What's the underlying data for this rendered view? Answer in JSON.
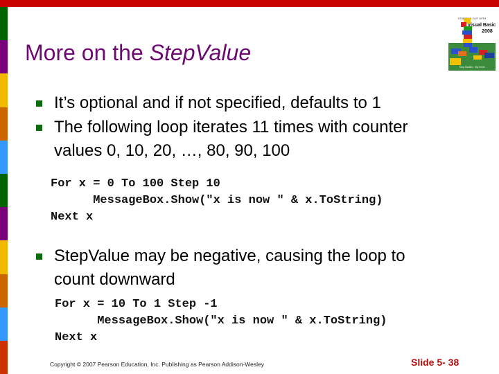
{
  "colors": {
    "top_bar": "#c80000",
    "title": "#6a0a6e",
    "bullet": "#0e6b0e",
    "slide_number": "#b01010",
    "side_stripes": [
      "#006400",
      "#7a007a",
      "#f2b800",
      "#cc6600",
      "#3399ff",
      "#006400",
      "#7a007a",
      "#f2b800",
      "#cc6600",
      "#3399ff",
      "#cc3300"
    ]
  },
  "title": {
    "prefix": "More on the ",
    "emphasis": "StepValue"
  },
  "bullets": [
    {
      "text": "It’s optional and if not specified, defaults to 1"
    },
    {
      "line1": "The following loop iterates 11 times with counter",
      "line2": "values 0, 10, 20, …, 80, 90, 100"
    },
    {
      "line1": "StepValue may be negative, causing the loop to",
      "line2": "count downward"
    }
  ],
  "code_blocks": [
    {
      "text": "For x = 0 To 100 Step 10\n      MessageBox.Show(\"x is now \" & x.ToString)\nNext x"
    },
    {
      "text": "For x = 10 To 1 Step -1\n      MessageBox.Show(\"x is now \" & x.ToString)\nNext x"
    }
  ],
  "book_cover": {
    "series": "STARTING OUT WITH",
    "title": "Visual Basic 2008",
    "authors": "Tony Gaddis · Kip Irvine"
  },
  "footer": {
    "copyright": "Copyright © 2007 Pearson Education, Inc. Publishing as Pearson Addison-Wesley",
    "slide_number": "Slide 5- 38"
  }
}
